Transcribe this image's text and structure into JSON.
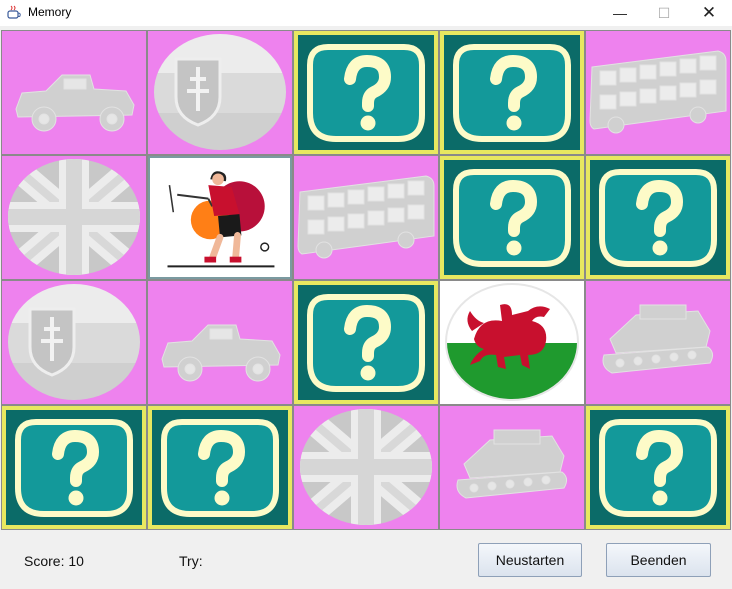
{
  "window": {
    "title": "Memory",
    "app_icon": "java-cup-icon",
    "controls": [
      "minimize-icon",
      "maximize-icon",
      "close-icon"
    ]
  },
  "board": {
    "rows": 4,
    "columns": 5,
    "cards": [
      [
        "jeep-faded",
        "slovakia-flag-faded",
        "question",
        "question",
        "bus-faded"
      ],
      [
        "union-jack-faded",
        "golfer-revealed",
        "bus-faded",
        "question",
        "question"
      ],
      [
        "slovakia-flag-faded",
        "jeep-faded",
        "question",
        "wales-flag-revealed",
        "tank-faded"
      ],
      [
        "question",
        "question",
        "union-jack-faded",
        "tank-faded",
        "question"
      ]
    ]
  },
  "colors": {
    "matched_bg": "#ee82ee",
    "hidden_frame": "#e8e860",
    "hidden_outer": "#0b6b68",
    "hidden_inner": "#13999a",
    "question_cream": "#fdfbc8",
    "faded_gray": "#d0d0d0"
  },
  "footer": {
    "score_text": "Score: 10",
    "try_text": "Try:",
    "restart_label": "Neustarten",
    "quit_label": "Beenden"
  }
}
